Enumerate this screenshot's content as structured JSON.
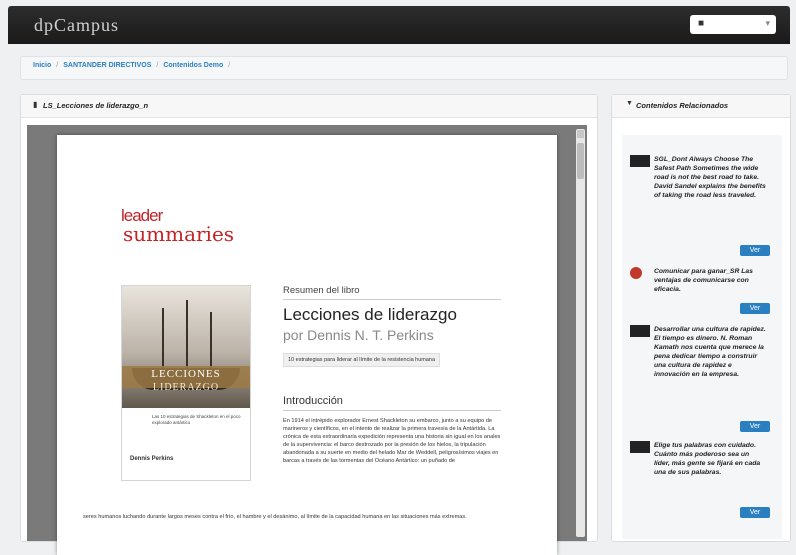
{
  "app": {
    "brand": "dpCampus"
  },
  "user_menu": {
    "icon": "user-icon",
    "caret": "▾"
  },
  "breadcrumb": {
    "items": [
      "Inicio",
      "SANTANDER DIRECTIVOS",
      "Contenidos Demo"
    ],
    "separator": "/"
  },
  "content_panel": {
    "icon": "document-icon",
    "title": "LS_Lecciones de liderazgo_n"
  },
  "document": {
    "logo_line1": "leader",
    "logo_line2": "summaries",
    "cover_title_1": "LECCIONES",
    "cover_title_2": "LIDERAZGO",
    "cover_subtitle": "Las 10 estrategias de Shackleton en el poco explorado antártico",
    "cover_brand": "Dennis Perkins",
    "kicker": "Resumen del libro",
    "book_title": "Lecciones de liderazgo",
    "book_author": "por Dennis N. T. Perkins",
    "book_subtitle": "10 estrategias para liderar al límite de la resistencia humana",
    "intro_heading": "Introducción",
    "intro_p1": "En 1914 el intrépido explorador Ernest Shackleton su embarco, junto a su equipo de marineros y científicos, en el intento de realizar la primera travesía de la Antártida. La crónica de esta extraordinaria expedición representa una historia sin igual en los anales de la supervivencia: el barco destrozado por la presión de los hielos, la tripulación abandonada a su suerte en medio del helado Mar de Weddell, peligrosísimos viajes en barcas a través de las tormentas del Océano Antártico: un puñado de",
    "intro_p2": "seres humanos luchando durante largos meses contra el frío, el hambre y el desánimo, al límite de la capacidad humana en las situaciones más extremas."
  },
  "related_panel": {
    "icon": "caret-down-icon",
    "title": "Contenidos Relacionados",
    "items": [
      {
        "text": "SGL_Dont Always Choose The Safest Path Sometimes the wide road is not the best road to take. David Sandel explains the benefits of taking the road less traveled.",
        "button": "Ver"
      },
      {
        "text": "Comunicar para ganar_SR Las ventajas de comunicarse con eficacia.",
        "button": "Ver"
      },
      {
        "text": "Desarrollar una cultura de rapidez. El tiempo es dinero. N. Roman Kamath nos cuenta que merece la pena dedicar tiempo a construir una cultura de rapidez e innovación en la empresa.",
        "button": "Ver"
      },
      {
        "text": "Elige tus palabras con cuidado. Cuánto más poderoso sea un líder, más gente se fijará en cada una de sus palabras.",
        "button": "Ver"
      }
    ]
  }
}
